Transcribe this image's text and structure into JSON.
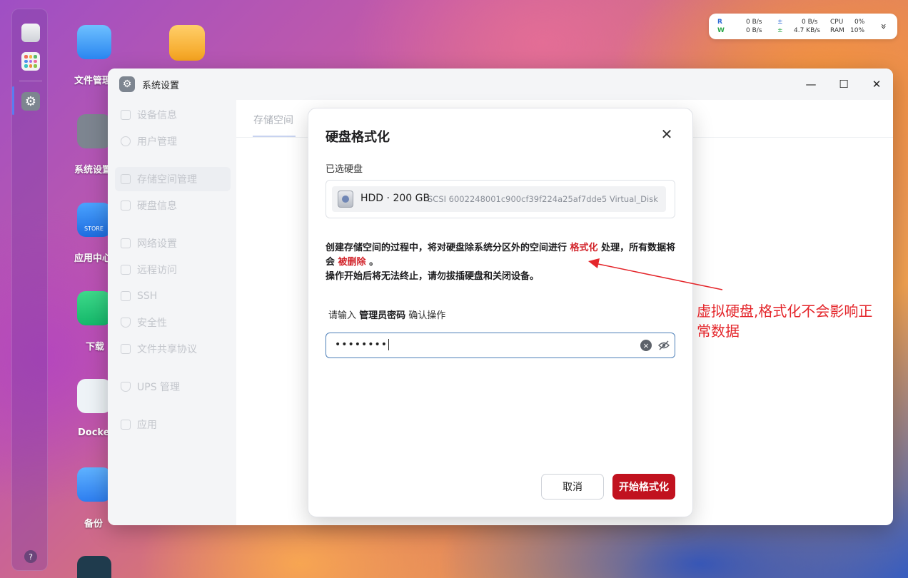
{
  "desktop": {
    "icons": [
      {
        "label": "文件管理"
      },
      {
        "label": "系统设置"
      },
      {
        "label": "应用中心"
      },
      {
        "label": "下载"
      },
      {
        "label": "Docker"
      },
      {
        "label": "备份"
      }
    ],
    "store_text": "STORE"
  },
  "monitor": {
    "r_label": "R",
    "w_label": "W",
    "r_down": "0  B/s",
    "r_up": "0  B/s",
    "w_down": "0  B/s",
    "w_up": "4.7 KB/s",
    "cpu_label": "CPU",
    "cpu_val": "0%",
    "ram_label": "RAM",
    "ram_val": "10%",
    "up_arrow": "±",
    "expand": "»"
  },
  "window": {
    "title": "系统设置",
    "minimize": "—",
    "maximize": "☐",
    "close": "✕"
  },
  "sidebar": {
    "items": [
      {
        "label": "设备信息"
      },
      {
        "label": "用户管理"
      },
      {
        "label": "存储空间管理"
      },
      {
        "label": "硬盘信息"
      },
      {
        "label": "网络设置"
      },
      {
        "label": "远程访问"
      },
      {
        "label": "SSH"
      },
      {
        "label": "安全性"
      },
      {
        "label": "文件共享协议"
      },
      {
        "label": "UPS 管理"
      },
      {
        "label": "应用"
      }
    ]
  },
  "content": {
    "tab": "存储空间"
  },
  "dialog": {
    "title": "硬盘格式化",
    "close": "✕",
    "selected_label": "已选硬盘",
    "disk_main": "HDD · 200 GB",
    "disk_sub": "SCSI  6002248001c900cf39f224a25af7dde5  Virtual_Disk",
    "warn_1": "创建存储空间的过程中，将对硬盘除系统分区外的空间进行 ",
    "warn_red_1": "格式化",
    "warn_2": " 处理，所有数据将会 ",
    "warn_red_2": "被删除",
    "warn_3": " 。",
    "warn_line2": "操作开始后将无法终止，请勿拔插硬盘和关闭设备。",
    "pwd_prefix": "请输入 ",
    "pwd_bold": "管理员密码",
    "pwd_suffix": " 确认操作",
    "pwd_value": "••••••••",
    "cancel": "取消",
    "format": "开始格式化"
  },
  "annotation": {
    "text": "虚拟硬盘,格式化不会影响正常数据"
  },
  "colors": {
    "danger": "#c1121f",
    "accent": "#4d7fb8",
    "annotation": "#e4262b"
  }
}
